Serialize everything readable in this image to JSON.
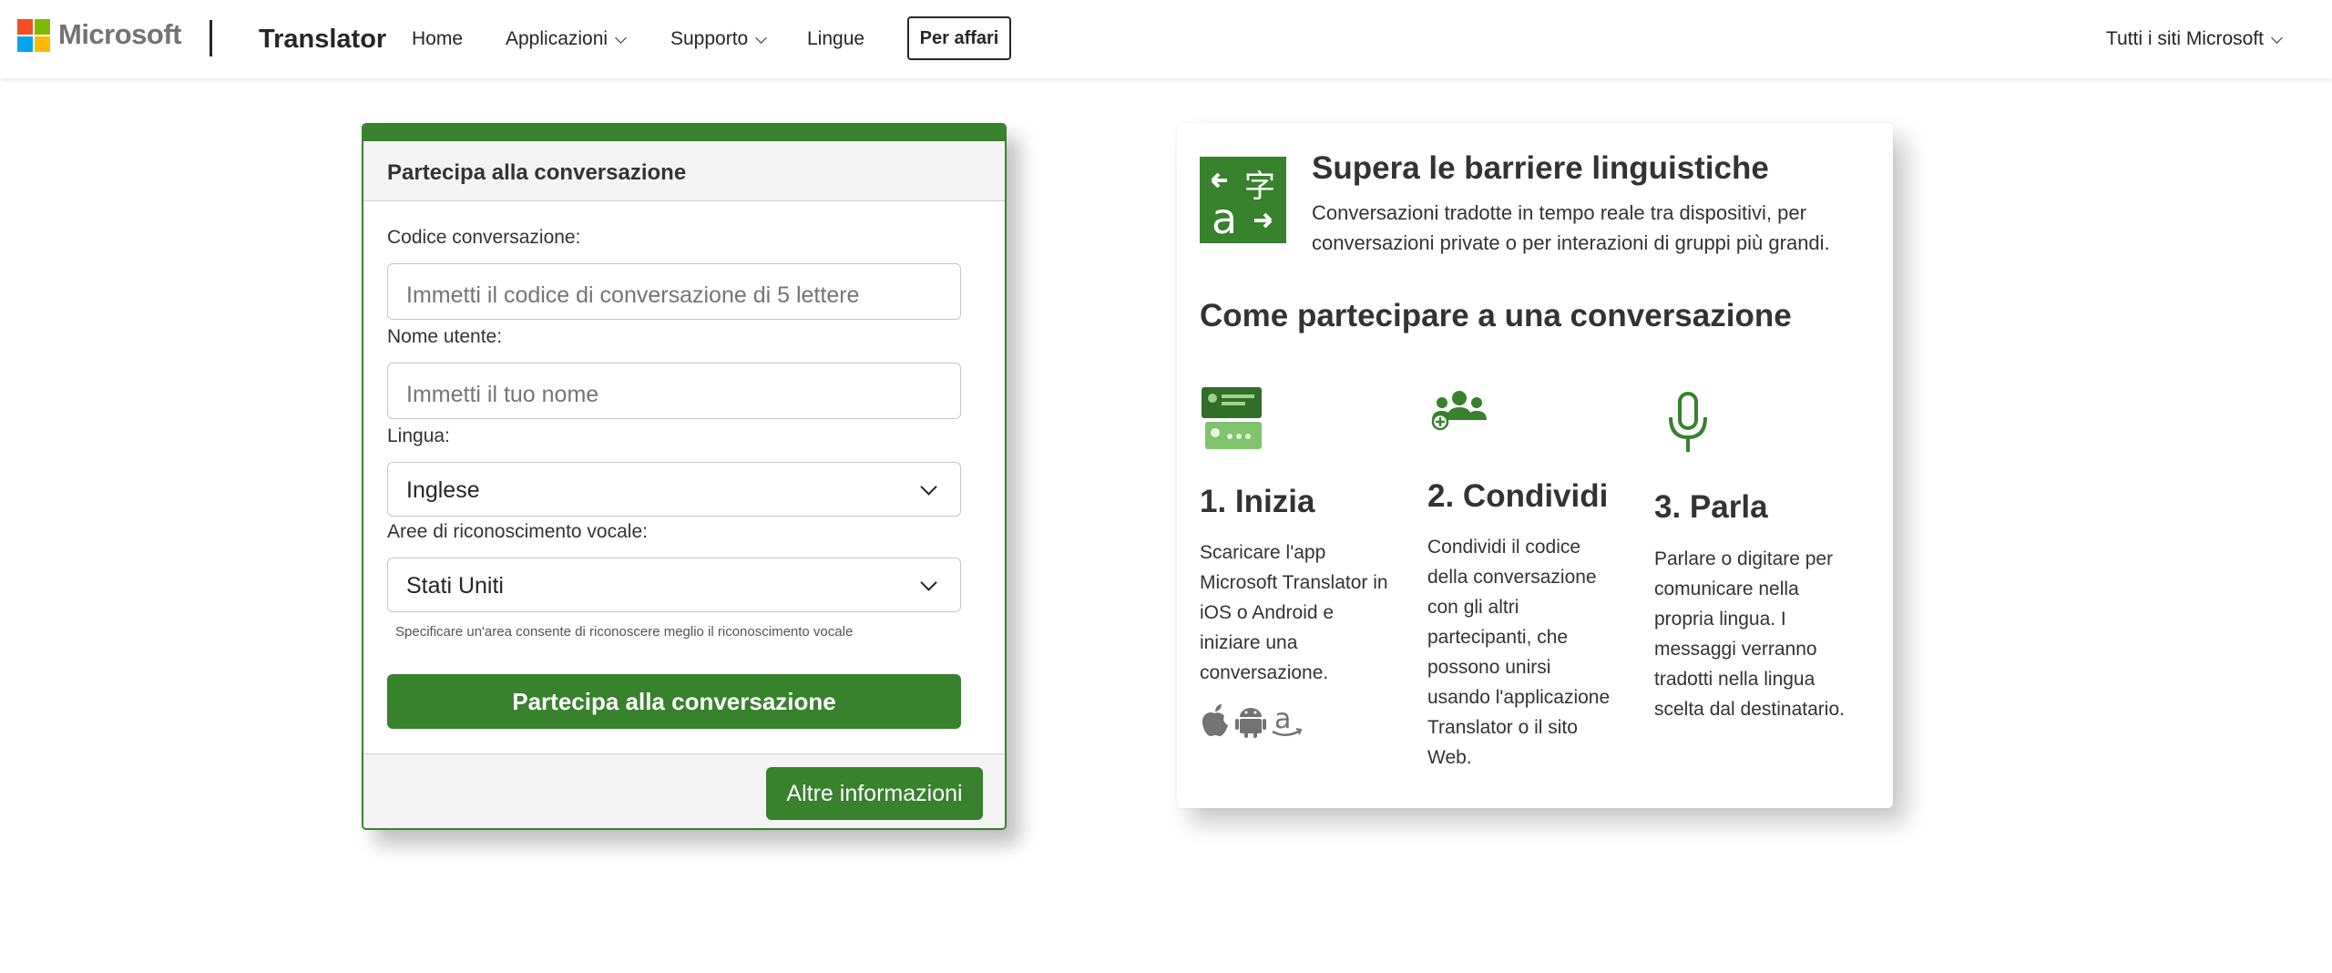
{
  "header": {
    "brand": "Microsoft",
    "app_name": "Translator",
    "nav": [
      {
        "label": "Home",
        "has_menu": false
      },
      {
        "label": "Applicazioni",
        "has_menu": true
      },
      {
        "label": "Supporto",
        "has_menu": true
      },
      {
        "label": "Lingue",
        "has_menu": false
      }
    ],
    "business_button": "Per affari",
    "all_sites": "Tutti i siti Microsoft"
  },
  "join": {
    "title": "Partecipa alla conversazione",
    "code_label": "Codice conversazione:",
    "code_placeholder": "Immetti il codice di conversazione di 5 lettere",
    "name_label": "Nome utente:",
    "name_placeholder": "Immetti il tuo nome",
    "language_label": "Lingua:",
    "language_value": "Inglese",
    "region_label": "Aree di riconoscimento vocale:",
    "region_value": "Stati Uniti",
    "hint": "Specificare un'area consente di riconoscere meglio il riconoscimento vocale",
    "join_button": "Partecipa alla conversazione",
    "more_button": "Altre informazioni"
  },
  "info": {
    "title": "Supera le barriere linguistiche",
    "description": "Conversazioni tradotte in tempo reale tra dispositivi, per conversazioni private o per interazioni di gruppi più grandi.",
    "how_title": "Come partecipare a una conversazione",
    "steps": [
      {
        "title": "1. Inizia",
        "text": "Scaricare l'app Microsoft Translator in iOS o Android e iniziare una conversazione.",
        "icon": "chat-bubbles-icon"
      },
      {
        "title": "2. Condividi",
        "text": "Condividi il codice della conversazione con gli altri partecipanti, che possono unirsi usando l'applicazione Translator o il sito Web.",
        "icon": "group-add-icon"
      },
      {
        "title": "3. Parla",
        "text": "Parlare o digitare per comunicare nella propria lingua. I messaggi verranno tradotti nella lingua scelta dal destinatario.",
        "icon": "microphone-icon"
      }
    ],
    "store_icons": [
      "apple-icon",
      "android-icon",
      "amazon-icon"
    ]
  },
  "colors": {
    "accent_green": "#38812d",
    "text": "#262626"
  }
}
